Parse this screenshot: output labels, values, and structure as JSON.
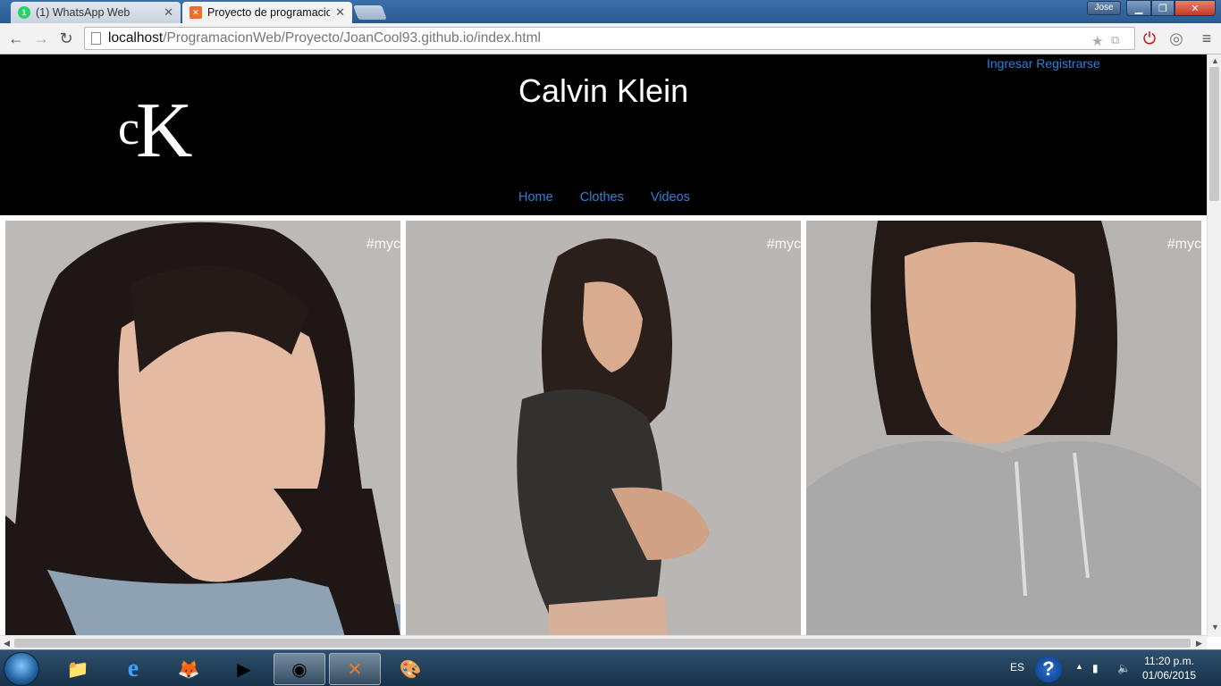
{
  "browser": {
    "tabs": [
      {
        "title": "(1) WhatsApp Web",
        "favicon": "whatsapp-icon",
        "color": "#25d366"
      },
      {
        "title": "Proyecto de programacion",
        "favicon": "xampp-icon",
        "color": "#e8702a"
      }
    ],
    "user": "Jose",
    "url_host": "localhost",
    "url_path": "/ProgramacionWeb/Proyecto/JoanCool93.github.io/index.html"
  },
  "site": {
    "title": "Calvin Klein",
    "logo_text": "cK",
    "auth_links": [
      "Ingresar",
      "Registrarse"
    ],
    "nav": [
      "Home",
      "Clothes",
      "Videos"
    ],
    "photo_tag": "#myc",
    "photos": [
      "photo-portrait-denim",
      "photo-leather-vest",
      "photo-grey-hoodie"
    ],
    "link_color": "#2f80d8"
  },
  "taskbar": {
    "apps": [
      "explorer-icon",
      "ie-icon",
      "firefox-icon",
      "media-icon",
      "chrome-icon",
      "xampp-icon",
      "paint-icon"
    ],
    "language": "ES",
    "time": "11:20 p.m.",
    "date": "01/06/2015"
  }
}
